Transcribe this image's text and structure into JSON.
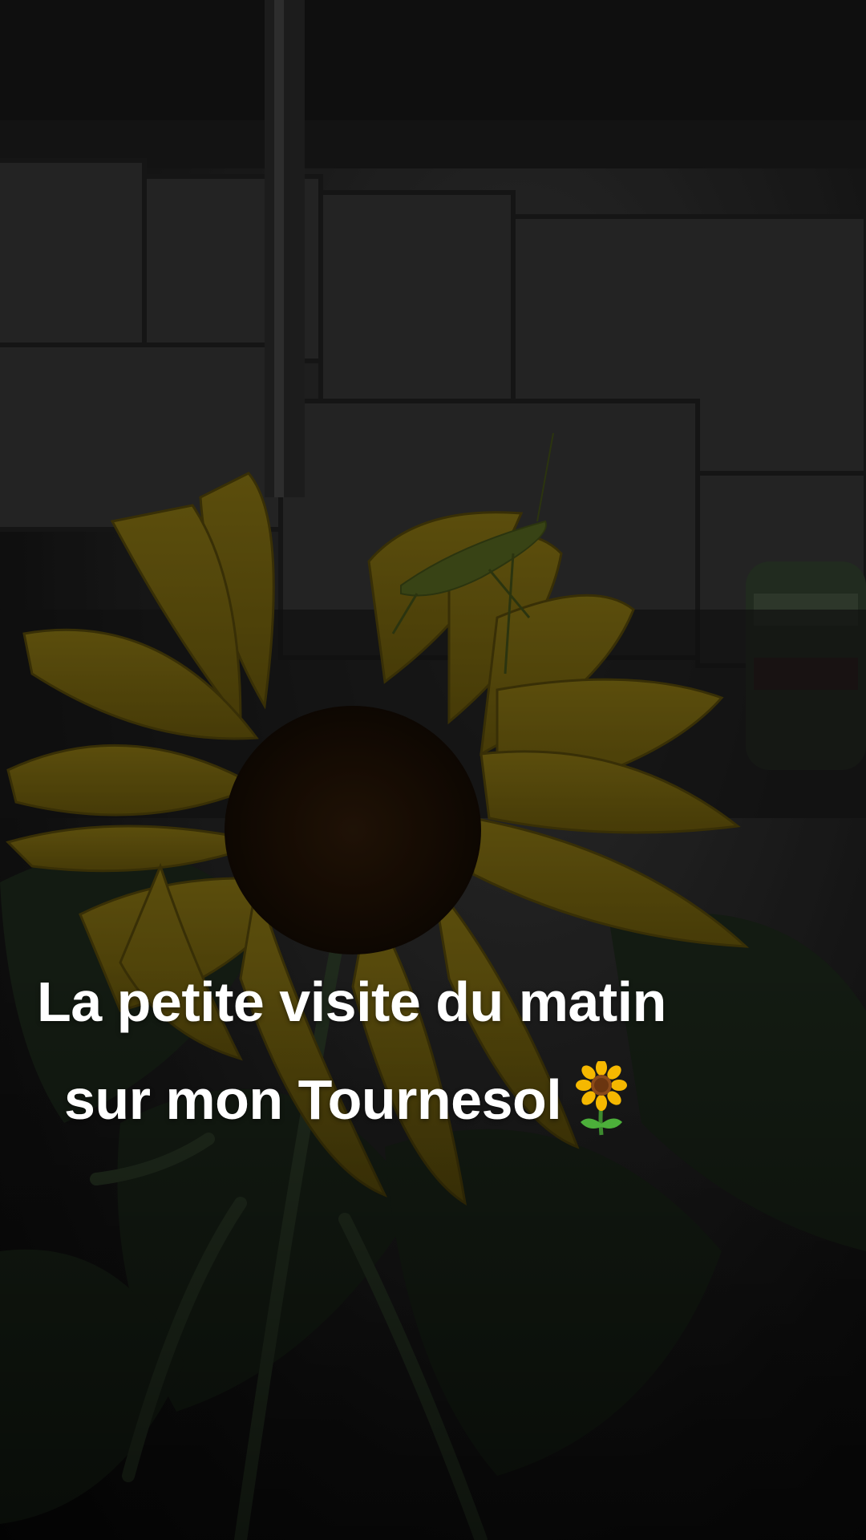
{
  "video": {
    "caption_line_1": "La petite visite du matin",
    "caption_line_2": "sur mon Tournesol",
    "caption_emoji": "sunflower-emoji"
  },
  "colors": {
    "petal": "#6b5a0c",
    "petal_light": "#7d6a12",
    "center": "#1c1005",
    "leaf": "#1d2a1a",
    "tile": "#3a3a3a",
    "insect": "#4a5a1a",
    "text": "#ffffff"
  }
}
